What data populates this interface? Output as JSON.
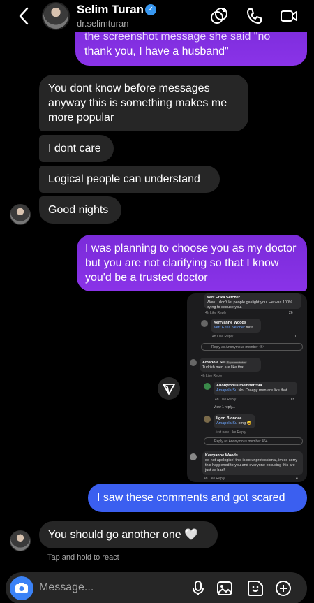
{
  "header": {
    "name": "Selim Turan",
    "username": "dr.selimturan"
  },
  "messages": {
    "cut_top": "the screenshot message she said \"no",
    "cut_bottom": "thank you, I have a husband\"",
    "m1": "You dont know before messages anyway this is something makes me more popular",
    "m2": "I dont care",
    "m3": "Logical people can understand",
    "m4": "Good nights",
    "m5": "I was planning to choose you as my doctor but you are not clarifying so that I know you'd be a trusted doctor",
    "m6": "I saw these comments and got scared",
    "m7": "You should go another one 🤍"
  },
  "screenshot": {
    "c1_name": "Kerr Erika Setcher",
    "c1_text": "Wow... don't let people gaslight you, He was 100% trying to seduce you.",
    "c1_meta": "4h   Like   Reply",
    "c1_count": "26",
    "c2_name": "Kerryanne Woods",
    "c2_mention": "Kerr Erika Setcher",
    "c2_text": "this!",
    "c2_meta": "4h   Like   Reply",
    "c2_count": "1",
    "reply1": "Reply as Anonymous member 464",
    "c3_name": "Amapola Su",
    "c3_badge": "Top contributor",
    "c3_text": "Turkish men are like that.",
    "c3_meta": "4h   Like   Reply",
    "c4_name": "Anonymous member 594",
    "c4_mention": "Amapola Su",
    "c4_text": "No. Creepy men are like that.",
    "c4_meta": "4h   Like   Reply",
    "c4_count": "13",
    "view_reply": "View 1 reply...",
    "c5_name": "Ilgon Blondee",
    "c5_mention": "Amapola Su",
    "c5_text": "omg 😂",
    "c5_meta": "Just now   Like   Reply",
    "reply2": "Reply as Anonymous member 464",
    "c6_name": "Kerryanne Woods",
    "c6_text": "do not apologise! this is so unprofessional, im so sorry this happened to you and everyone excusing this are just as bad!",
    "c6_meta": "4h   Like   Reply",
    "c6_count": "4"
  },
  "hint": "Tap and hold to react",
  "composer": {
    "placeholder": "Message..."
  },
  "colors": {
    "outgoing_purple": "#8a33e8",
    "outgoing_blue": "#3b5ff0",
    "incoming": "#262626",
    "camera": "#3b82f6",
    "verified": "#3897f0"
  }
}
